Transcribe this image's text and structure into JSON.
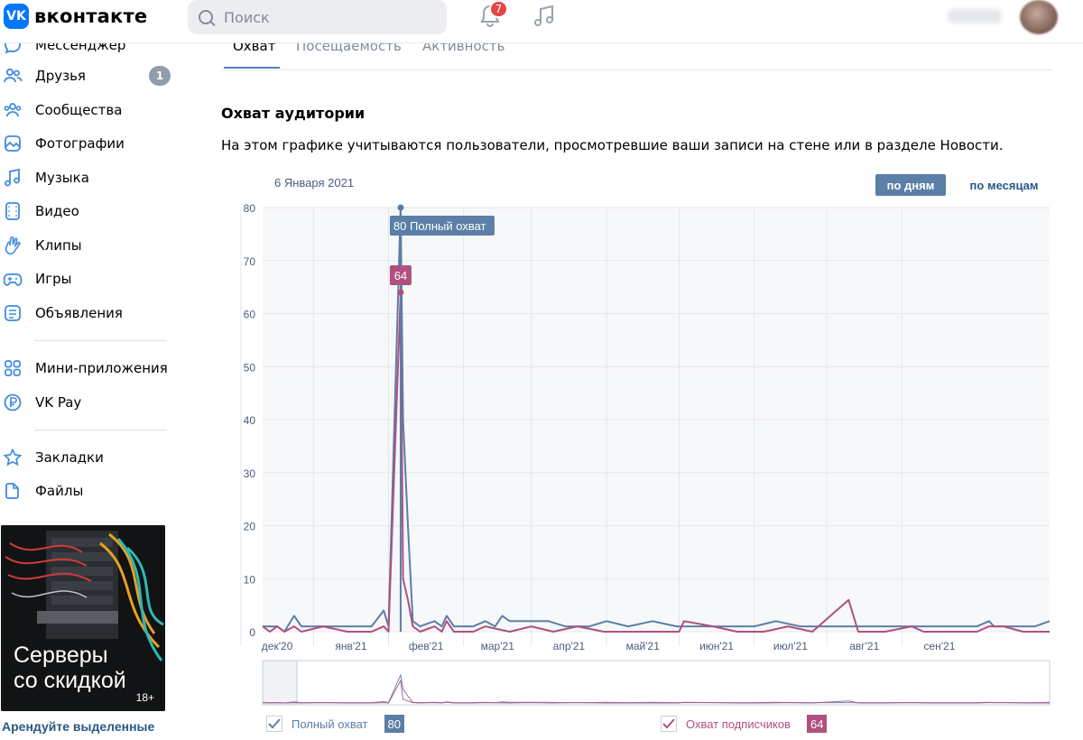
{
  "header": {
    "logo_text": "вконтакте",
    "logo_mark": "VK",
    "search_placeholder": "Поиск",
    "notifications_count": "7",
    "icons": [
      "search-icon",
      "bell-icon",
      "music-icon"
    ]
  },
  "sidebar": {
    "items": [
      {
        "label": "Мессенджер",
        "icon": "messenger-icon"
      },
      {
        "label": "Друзья",
        "icon": "friends-icon",
        "badge": "1"
      },
      {
        "label": "Сообщества",
        "icon": "communities-icon"
      },
      {
        "label": "Фотографии",
        "icon": "photos-icon"
      },
      {
        "label": "Музыка",
        "icon": "music-icon"
      },
      {
        "label": "Видео",
        "icon": "video-icon"
      },
      {
        "label": "Клипы",
        "icon": "clips-icon"
      },
      {
        "label": "Игры",
        "icon": "games-icon"
      },
      {
        "label": "Объявления",
        "icon": "ads-icon"
      },
      {
        "label": "Мини-приложения",
        "icon": "mini-apps-icon"
      },
      {
        "label": "VK Pay",
        "icon": "vk-pay-icon"
      },
      {
        "label": "Закладки",
        "icon": "bookmarks-icon"
      },
      {
        "label": "Файлы",
        "icon": "files-icon"
      }
    ],
    "ad": {
      "title_line1": "Серверы",
      "title_line2": "со скидкой",
      "age": "18+",
      "caption": "Арендуйте выделенные"
    }
  },
  "tabs": [
    {
      "label": "Охват",
      "active": true
    },
    {
      "label": "Посещаемость",
      "active": false
    },
    {
      "label": "Активность",
      "active": false
    }
  ],
  "section": {
    "title": "Охват аудитории",
    "description": "На этом графике учитываются пользователи, просмотревшие ваши записи на стене или в разделе Новости."
  },
  "controls": {
    "selected_date": "6 Января 2021",
    "by_days": "по дням",
    "by_months": "по месяцам"
  },
  "colors": {
    "full_reach": "#5b7fa6",
    "subscriber_reach": "#b0507f",
    "accent": "#5181b8"
  },
  "legend": {
    "full_reach_label": "Полный охват",
    "full_reach_value": "80",
    "subscriber_label": "Охват подписчиков",
    "subscriber_value": "64"
  },
  "tooltip": {
    "full_reach": "80 Полный охват",
    "subscriber": "64"
  },
  "chart_data": {
    "type": "line",
    "ylim": [
      0,
      80
    ],
    "yticks": [
      0,
      10,
      20,
      30,
      40,
      50,
      60,
      70,
      80
    ],
    "month_labels": [
      "дек'20",
      "янв'21",
      "фев'21",
      "мар'21",
      "апр'21",
      "май'21",
      "июн'21",
      "июл'21",
      "авг'21",
      "сен'21"
    ],
    "x_start": "2020-11-10",
    "x_end": "2021-10-01",
    "grid": true,
    "series": [
      {
        "name": "Полный охват",
        "points": [
          [
            "2020-11-10",
            1
          ],
          [
            "2020-11-16",
            1
          ],
          [
            "2020-11-19",
            0
          ],
          [
            "2020-11-23",
            3
          ],
          [
            "2020-11-26",
            1
          ],
          [
            "2020-12-05",
            1
          ],
          [
            "2020-12-15",
            1
          ],
          [
            "2020-12-25",
            1
          ],
          [
            "2020-12-30",
            4
          ],
          [
            "2021-01-01",
            1
          ],
          [
            "2021-01-06",
            80
          ],
          [
            "2021-01-07",
            40
          ],
          [
            "2021-01-09",
            20
          ],
          [
            "2021-01-11",
            2
          ],
          [
            "2021-01-14",
            1
          ],
          [
            "2021-01-20",
            2
          ],
          [
            "2021-01-23",
            1
          ],
          [
            "2021-01-25",
            3
          ],
          [
            "2021-01-28",
            1
          ],
          [
            "2021-02-05",
            1
          ],
          [
            "2021-02-10",
            2
          ],
          [
            "2021-02-14",
            1
          ],
          [
            "2021-02-17",
            3
          ],
          [
            "2021-02-20",
            2
          ],
          [
            "2021-03-01",
            2
          ],
          [
            "2021-03-08",
            2
          ],
          [
            "2021-03-15",
            1
          ],
          [
            "2021-03-25",
            1
          ],
          [
            "2021-04-01",
            2
          ],
          [
            "2021-04-10",
            1
          ],
          [
            "2021-04-20",
            2
          ],
          [
            "2021-04-30",
            1
          ],
          [
            "2021-05-10",
            1
          ],
          [
            "2021-05-20",
            1
          ],
          [
            "2021-06-01",
            1
          ],
          [
            "2021-06-10",
            2
          ],
          [
            "2021-06-20",
            1
          ],
          [
            "2021-07-01",
            1
          ],
          [
            "2021-07-10",
            1
          ],
          [
            "2021-07-20",
            1
          ],
          [
            "2021-08-01",
            1
          ],
          [
            "2021-08-15",
            1
          ],
          [
            "2021-09-01",
            1
          ],
          [
            "2021-09-06",
            2
          ],
          [
            "2021-09-08",
            1
          ],
          [
            "2021-09-25",
            1
          ],
          [
            "2021-10-01",
            2
          ]
        ]
      },
      {
        "name": "Охват подписчиков",
        "points": [
          [
            "2020-11-10",
            1
          ],
          [
            "2020-11-13",
            0
          ],
          [
            "2020-11-16",
            1
          ],
          [
            "2020-11-19",
            0
          ],
          [
            "2020-11-23",
            1
          ],
          [
            "2020-11-26",
            0
          ],
          [
            "2020-12-05",
            1
          ],
          [
            "2020-12-15",
            0
          ],
          [
            "2020-12-25",
            0
          ],
          [
            "2020-12-30",
            1
          ],
          [
            "2021-01-01",
            0
          ],
          [
            "2021-01-06",
            64
          ],
          [
            "2021-01-07",
            10
          ],
          [
            "2021-01-09",
            6
          ],
          [
            "2021-01-11",
            1
          ],
          [
            "2021-01-14",
            0
          ],
          [
            "2021-01-20",
            1
          ],
          [
            "2021-01-23",
            0
          ],
          [
            "2021-01-25",
            2
          ],
          [
            "2021-01-28",
            0
          ],
          [
            "2021-02-05",
            0
          ],
          [
            "2021-02-10",
            1
          ],
          [
            "2021-02-20",
            0
          ],
          [
            "2021-03-01",
            1
          ],
          [
            "2021-03-10",
            0
          ],
          [
            "2021-03-20",
            1
          ],
          [
            "2021-03-31",
            0
          ],
          [
            "2021-04-15",
            0
          ],
          [
            "2021-05-01",
            0
          ],
          [
            "2021-05-03",
            2
          ],
          [
            "2021-05-15",
            1
          ],
          [
            "2021-05-25",
            0
          ],
          [
            "2021-06-05",
            0
          ],
          [
            "2021-06-15",
            1
          ],
          [
            "2021-06-25",
            0
          ],
          [
            "2021-07-10",
            6
          ],
          [
            "2021-07-14",
            0
          ],
          [
            "2021-07-25",
            0
          ],
          [
            "2021-08-05",
            1
          ],
          [
            "2021-08-10",
            0
          ],
          [
            "2021-08-25",
            0
          ],
          [
            "2021-09-01",
            0
          ],
          [
            "2021-09-06",
            1
          ],
          [
            "2021-09-12",
            1
          ],
          [
            "2021-09-20",
            0
          ],
          [
            "2021-10-01",
            0
          ]
        ]
      }
    ]
  }
}
